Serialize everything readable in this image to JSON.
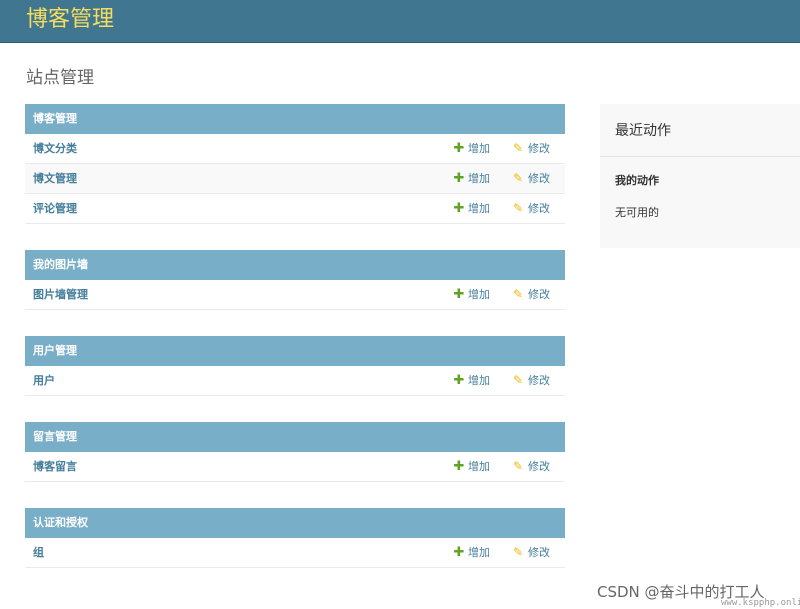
{
  "header": {
    "brand": "博客管理"
  },
  "page_title": "站点管理",
  "actions": {
    "add_label": "增加",
    "change_label": "修改",
    "add_icon": "plus-icon",
    "change_icon": "pencil-icon"
  },
  "modules": [
    {
      "caption": "博客管理",
      "items": [
        "博文分类",
        "博文管理",
        "评论管理"
      ]
    },
    {
      "caption": "我的图片墙",
      "items": [
        "图片墙管理"
      ]
    },
    {
      "caption": "用户管理",
      "items": [
        "用户"
      ]
    },
    {
      "caption": "留言管理",
      "items": [
        "博客留言"
      ]
    },
    {
      "caption": "认证和授权",
      "items": [
        "组"
      ]
    }
  ],
  "recent_actions": {
    "title": "最近动作",
    "subtitle": "我的动作",
    "empty_text": "无可用的"
  },
  "watermark": {
    "text": "CSDN @奋斗中的打工人",
    "site": "www.kspphp.online"
  },
  "colors": {
    "header": "#417690",
    "brand": "#f5dd5d",
    "caption": "#79aec8",
    "link": "#447e9b",
    "add_icon": "#5fa225",
    "change_icon": "#efb80b"
  }
}
